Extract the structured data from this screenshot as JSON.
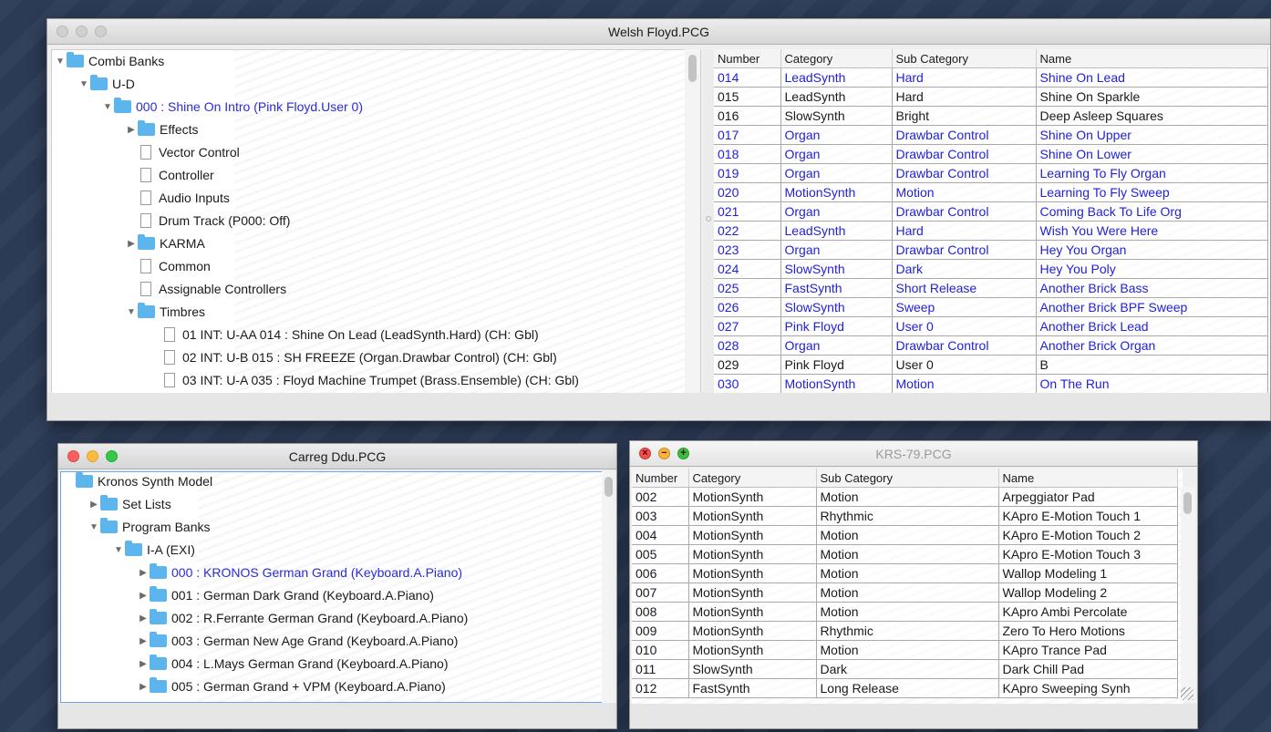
{
  "win1": {
    "title": "Welsh Floyd.PCG",
    "tree": [
      {
        "indent": 0,
        "arrow": "▼",
        "icon": "folder",
        "label": "Combi Banks",
        "blue": false
      },
      {
        "indent": 1,
        "arrow": "▼",
        "icon": "folder",
        "label": "U-D",
        "blue": false
      },
      {
        "indent": 2,
        "arrow": "▼",
        "icon": "folder",
        "label": "000  : Shine On Intro (Pink Floyd.User 0)",
        "blue": true
      },
      {
        "indent": 3,
        "arrow": "▶",
        "icon": "folder",
        "label": "Effects",
        "blue": false
      },
      {
        "indent": 3,
        "arrow": "",
        "icon": "doc",
        "label": "Vector Control",
        "blue": false
      },
      {
        "indent": 3,
        "arrow": "",
        "icon": "doc",
        "label": "Controller",
        "blue": false
      },
      {
        "indent": 3,
        "arrow": "",
        "icon": "doc",
        "label": "Audio Inputs",
        "blue": false
      },
      {
        "indent": 3,
        "arrow": "",
        "icon": "doc",
        "label": "Drum Track (P000: Off)",
        "blue": false
      },
      {
        "indent": 3,
        "arrow": "▶",
        "icon": "folder",
        "label": "KARMA",
        "blue": false
      },
      {
        "indent": 3,
        "arrow": "",
        "icon": "doc",
        "label": "Common",
        "blue": false
      },
      {
        "indent": 3,
        "arrow": "",
        "icon": "doc",
        "label": "Assignable Controllers",
        "blue": false
      },
      {
        "indent": 3,
        "arrow": "▼",
        "icon": "folder",
        "label": "Timbres",
        "blue": false
      },
      {
        "indent": 4,
        "arrow": "",
        "icon": "doc",
        "label": "01 INT: U-AA 014   : Shine On Lead (LeadSynth.Hard) (CH: Gbl)",
        "blue": false
      },
      {
        "indent": 4,
        "arrow": "",
        "icon": "doc",
        "label": "02 INT: U-B 015   : SH FREEZE (Organ.Drawbar Control) (CH: Gbl)",
        "blue": false
      },
      {
        "indent": 4,
        "arrow": "",
        "icon": "doc",
        "label": "03 INT: U-A 035   : Floyd Machine Trumpet (Brass.Ensemble) (CH: Gbl)",
        "blue": false
      }
    ],
    "table": {
      "headers": [
        "Number",
        "Category",
        "Sub Category",
        "Name"
      ],
      "rows": [
        {
          "c": [
            "014",
            "LeadSynth",
            "Hard",
            "Shine On Lead"
          ],
          "sel": true
        },
        {
          "c": [
            "015",
            "LeadSynth",
            "Hard",
            "Shine On Sparkle"
          ],
          "sel": false
        },
        {
          "c": [
            "016",
            "SlowSynth",
            "Bright",
            "Deep Asleep Squares"
          ],
          "sel": false
        },
        {
          "c": [
            "017",
            "Organ",
            "Drawbar Control",
            "Shine On Upper"
          ],
          "sel": true
        },
        {
          "c": [
            "018",
            "Organ",
            "Drawbar Control",
            "Shine On Lower"
          ],
          "sel": true
        },
        {
          "c": [
            "019",
            "Organ",
            "Drawbar Control",
            "Learning To Fly Organ"
          ],
          "sel": true
        },
        {
          "c": [
            "020",
            "MotionSynth",
            "Motion",
            "Learning To Fly Sweep"
          ],
          "sel": true
        },
        {
          "c": [
            "021",
            "Organ",
            "Drawbar Control",
            "Coming Back To Life Org"
          ],
          "sel": true
        },
        {
          "c": [
            "022",
            "LeadSynth",
            "Hard",
            "Wish You Were Here"
          ],
          "sel": true
        },
        {
          "c": [
            "023",
            "Organ",
            "Drawbar Control",
            "Hey You Organ"
          ],
          "sel": true
        },
        {
          "c": [
            "024",
            "SlowSynth",
            "Dark",
            "Hey You Poly"
          ],
          "sel": true
        },
        {
          "c": [
            "025",
            "FastSynth",
            "Short Release",
            "Another Brick Bass"
          ],
          "sel": true
        },
        {
          "c": [
            "026",
            "SlowSynth",
            "Sweep",
            "Another Brick BPF Sweep"
          ],
          "sel": true
        },
        {
          "c": [
            "027",
            "Pink Floyd",
            "User 0",
            "Another Brick Lead"
          ],
          "sel": true
        },
        {
          "c": [
            "028",
            "Organ",
            "Drawbar Control",
            "Another Brick Organ"
          ],
          "sel": true
        },
        {
          "c": [
            "029",
            "Pink Floyd",
            "User 0",
            "B"
          ],
          "sel": false
        },
        {
          "c": [
            "030",
            "MotionSynth",
            "Motion",
            "On The Run"
          ],
          "sel": true
        }
      ]
    }
  },
  "win2": {
    "title": "Carreg Ddu.PCG",
    "tree": [
      {
        "indent": 0,
        "arrow": "",
        "icon": "folder",
        "label": "Kronos Synth Model",
        "blue": false
      },
      {
        "indent": 1,
        "arrow": "▶",
        "icon": "folder",
        "label": "Set Lists",
        "blue": false
      },
      {
        "indent": 1,
        "arrow": "▼",
        "icon": "folder",
        "label": "Program Banks",
        "blue": false
      },
      {
        "indent": 2,
        "arrow": "▼",
        "icon": "folder",
        "label": "I-A (EXI)",
        "blue": false
      },
      {
        "indent": 3,
        "arrow": "▶",
        "icon": "folder",
        "label": "000  : KRONOS German Grand (Keyboard.A.Piano)",
        "blue": true
      },
      {
        "indent": 3,
        "arrow": "▶",
        "icon": "folder",
        "label": "001  : German Dark Grand (Keyboard.A.Piano)",
        "blue": false
      },
      {
        "indent": 3,
        "arrow": "▶",
        "icon": "folder",
        "label": "002  : R.Ferrante German Grand (Keyboard.A.Piano)",
        "blue": false
      },
      {
        "indent": 3,
        "arrow": "▶",
        "icon": "folder",
        "label": "003  : German New Age Grand (Keyboard.A.Piano)",
        "blue": false
      },
      {
        "indent": 3,
        "arrow": "▶",
        "icon": "folder",
        "label": "004  : L.Mays German Grand (Keyboard.A.Piano)",
        "blue": false
      },
      {
        "indent": 3,
        "arrow": "▶",
        "icon": "folder",
        "label": "005  : German Grand + VPM (Keyboard.A.Piano)",
        "blue": false
      }
    ]
  },
  "win3": {
    "title": "KRS-79.PCG",
    "table": {
      "headers": [
        "Number",
        "Category",
        "Sub Category",
        "Name"
      ],
      "rows": [
        {
          "c": [
            "002",
            "MotionSynth",
            "Motion",
            "Arpeggiator Pad"
          ],
          "sel": false
        },
        {
          "c": [
            "003",
            "MotionSynth",
            "Rhythmic",
            "KApro E-Motion Touch 1"
          ],
          "sel": false
        },
        {
          "c": [
            "004",
            "MotionSynth",
            "Motion",
            "KApro E-Motion Touch 2"
          ],
          "sel": false
        },
        {
          "c": [
            "005",
            "MotionSynth",
            "Motion",
            "KApro E-Motion Touch 3"
          ],
          "sel": false
        },
        {
          "c": [
            "006",
            "MotionSynth",
            "Motion",
            "Wallop Modeling 1"
          ],
          "sel": false
        },
        {
          "c": [
            "007",
            "MotionSynth",
            "Motion",
            "Wallop Modeling 2"
          ],
          "sel": false
        },
        {
          "c": [
            "008",
            "MotionSynth",
            "Motion",
            "KApro Ambi Percolate"
          ],
          "sel": false
        },
        {
          "c": [
            "009",
            "MotionSynth",
            "Rhythmic",
            "Zero To Hero Motions"
          ],
          "sel": false
        },
        {
          "c": [
            "010",
            "MotionSynth",
            "Motion",
            "KApro Trance Pad"
          ],
          "sel": false
        },
        {
          "c": [
            "011",
            "SlowSynth",
            "Dark",
            "Dark Chill Pad"
          ],
          "sel": false
        },
        {
          "c": [
            "012",
            "FastSynth",
            "Long Release",
            "KApro Sweeping Synh"
          ],
          "sel": false
        }
      ]
    }
  }
}
